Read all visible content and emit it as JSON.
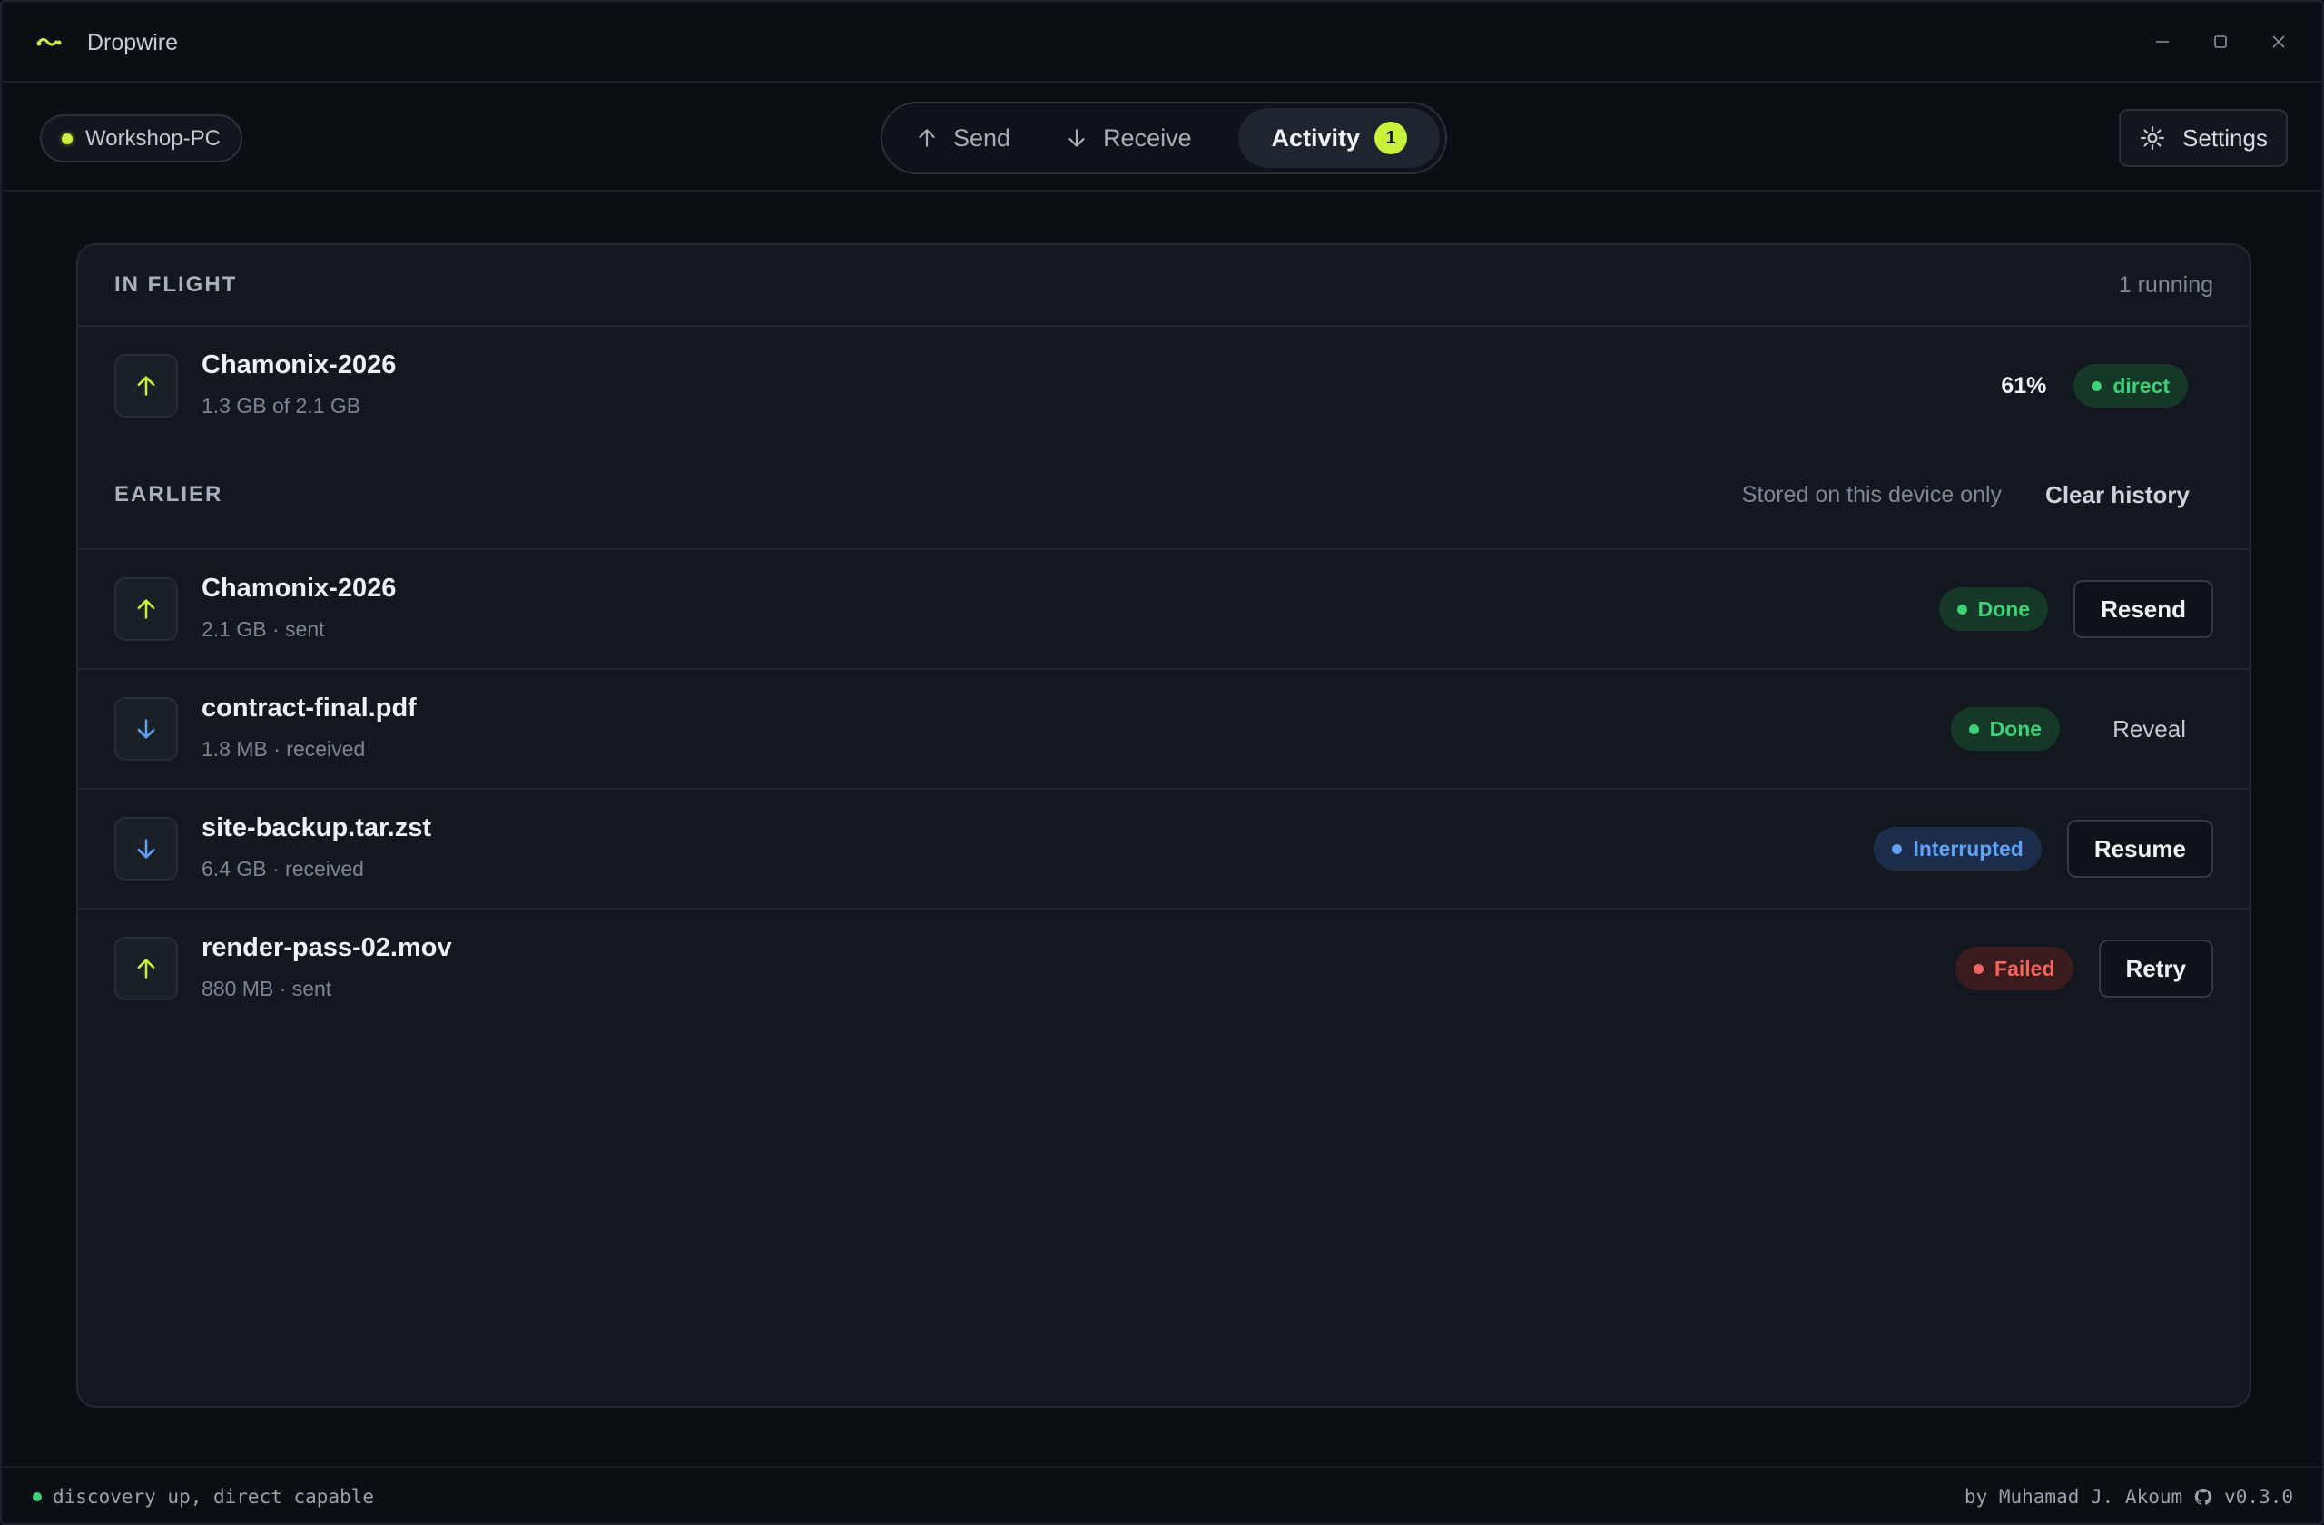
{
  "app": {
    "title": "Dropwire",
    "accent": "#c8f23b"
  },
  "device": {
    "name": "Workshop-PC",
    "status_color": "#c8f23b"
  },
  "tabs": [
    {
      "label": "Send",
      "icon": "arrow-up-icon"
    },
    {
      "label": "Receive",
      "icon": "arrow-down-icon"
    },
    {
      "label": "Activity",
      "badge": "1",
      "active": true
    }
  ],
  "settings": {
    "label": "Settings",
    "icon": "gear-icon"
  },
  "in_flight": {
    "label": "IN FLIGHT",
    "count_text": "1 running",
    "items": [
      {
        "name": "Chamonix-2026",
        "sub": "1.3 GB of 2.1 GB",
        "direction": "up",
        "percent": "61%",
        "route": "direct"
      }
    ]
  },
  "earlier": {
    "label": "EARLIER",
    "note": "Stored on this device only",
    "clear_label": "Clear history",
    "items": [
      {
        "name": "Chamonix-2026",
        "sub": "2.1 GB · sent",
        "direction": "up",
        "status": "Done",
        "action": "Resend"
      },
      {
        "name": "contract-final.pdf",
        "sub": "1.8 MB · received",
        "direction": "down",
        "status": "Done",
        "action": "Reveal"
      },
      {
        "name": "site-backup.tar.zst",
        "sub": "6.4 GB · received",
        "direction": "down",
        "status": "Interrupted",
        "action": "Resume"
      },
      {
        "name": "render-pass-02.mov",
        "sub": "880 MB · sent",
        "direction": "up",
        "status": "Failed",
        "action": "Retry"
      }
    ]
  },
  "statusbar": {
    "left": "discovery up, direct capable",
    "author": "by Muhamad J. Akoum",
    "version": "v0.3.0"
  },
  "colors": {
    "upload_arrow": "#c8f23b",
    "download_arrow": "#5fa1f5",
    "done": "#3fd07a",
    "interrupted": "#5fa1f5",
    "failed": "#f0665c"
  }
}
